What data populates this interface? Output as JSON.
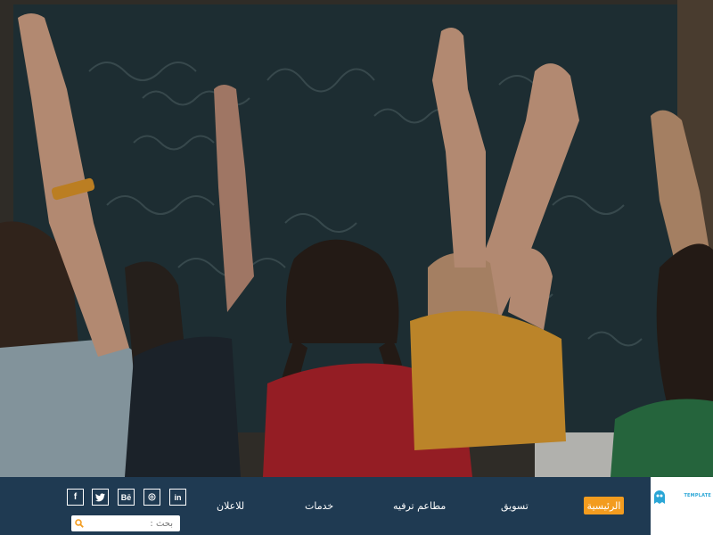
{
  "hero": {
    "image_description_icon": "classroom-photo"
  },
  "nav": {
    "items": [
      {
        "label": "الرئيسية",
        "active": true
      },
      {
        "label": "تسويق",
        "active": false
      },
      {
        "label": "مطاعم ترفيه",
        "active": false
      },
      {
        "label": "خدمات",
        "active": false
      },
      {
        "label": "للاعلان",
        "active": false
      }
    ],
    "active_color": "#f39c1f",
    "bar_color": "#1f3a52"
  },
  "social": {
    "items": [
      {
        "icon": "facebook-icon",
        "glyph": "f"
      },
      {
        "icon": "twitter-icon",
        "glyph": "t"
      },
      {
        "icon": "behance-icon",
        "glyph": "Bē"
      },
      {
        "icon": "dribbble-icon",
        "glyph": "◎"
      },
      {
        "icon": "linkedin-icon",
        "glyph": "in"
      }
    ]
  },
  "search": {
    "placeholder": "بحث :",
    "value": ""
  },
  "logo": {
    "text": "TEMPLATE",
    "icon": "ghost-icon",
    "color": "#2aa6d6"
  }
}
